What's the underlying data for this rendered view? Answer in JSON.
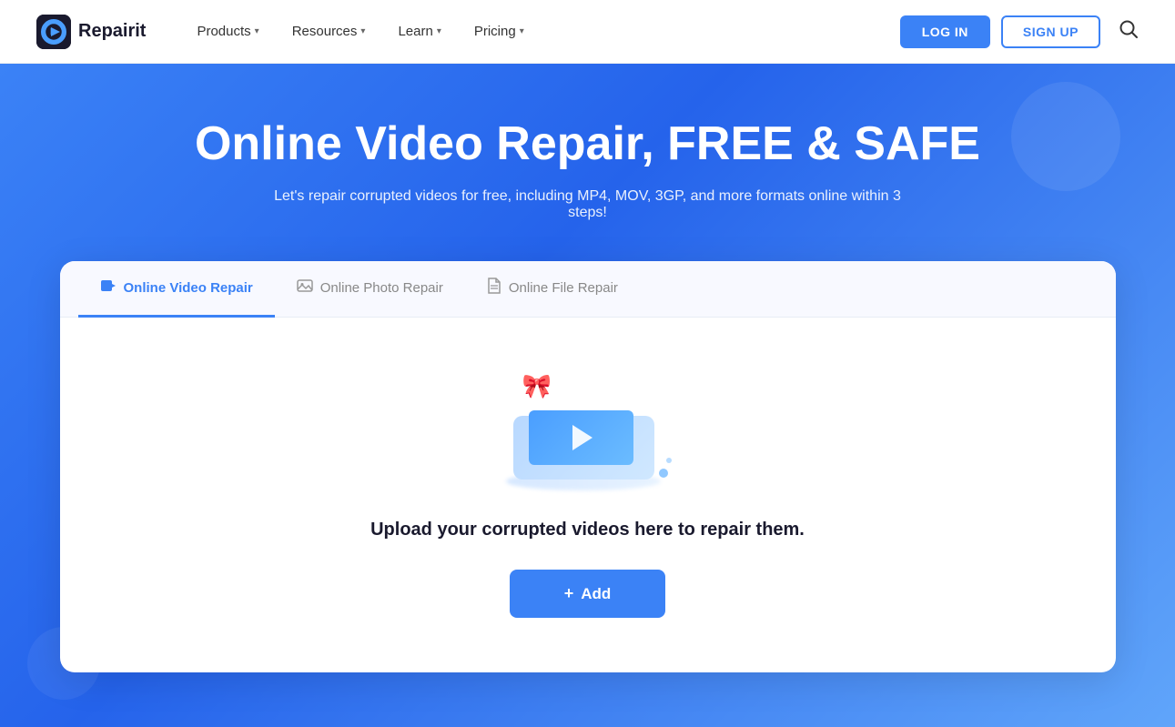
{
  "header": {
    "logo_text": "Repairit",
    "nav": [
      {
        "id": "products",
        "label": "Products",
        "has_dropdown": true
      },
      {
        "id": "resources",
        "label": "Resources",
        "has_dropdown": true
      },
      {
        "id": "learn",
        "label": "Learn",
        "has_dropdown": true
      },
      {
        "id": "pricing",
        "label": "Pricing",
        "has_dropdown": true
      }
    ],
    "login_label": "LOG IN",
    "signup_label": "SIGN UP"
  },
  "hero": {
    "title": "Online Video Repair, FREE & SAFE",
    "subtitle": "Let's repair corrupted videos for free, including MP4, MOV, 3GP, and more formats online within 3 steps!"
  },
  "tabs": [
    {
      "id": "video",
      "label": "Online Video Repair",
      "icon": "▶",
      "active": true
    },
    {
      "id": "photo",
      "label": "Online Photo Repair",
      "icon": "🖼",
      "active": false
    },
    {
      "id": "file",
      "label": "Online File Repair",
      "icon": "📄",
      "active": false
    }
  ],
  "upload": {
    "text": "Upload your corrupted videos here to repair them.",
    "add_label": "Add"
  }
}
